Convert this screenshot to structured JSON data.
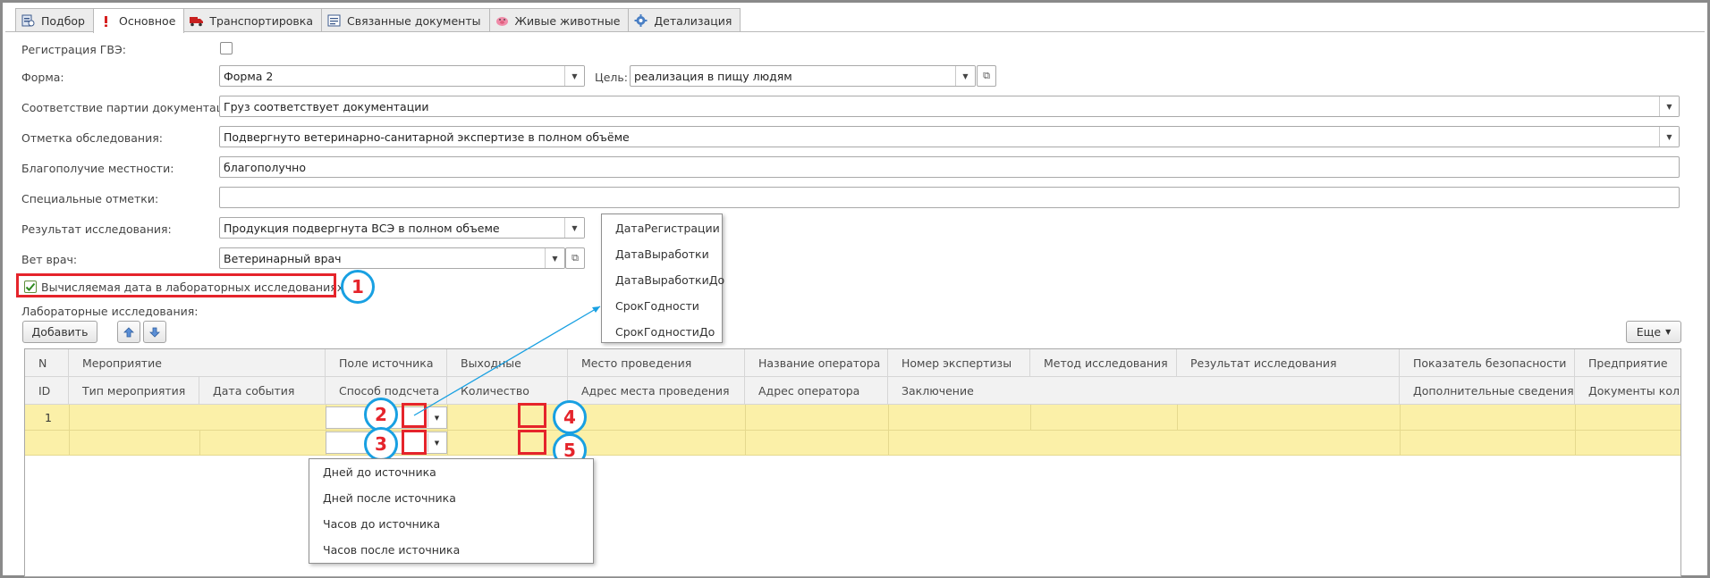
{
  "tabs": [
    {
      "label": "Подбор",
      "icon": "selection-doc-icon",
      "active": false
    },
    {
      "label": "Основное",
      "icon": "exclamation-icon",
      "active": true
    },
    {
      "label": "Транспортировка",
      "icon": "truck-icon",
      "active": false
    },
    {
      "label": "Связанные документы",
      "icon": "linked-docs-icon",
      "active": false
    },
    {
      "label": "Живые животные",
      "icon": "pig-icon",
      "active": false
    },
    {
      "label": "Детализация",
      "icon": "gear-icon",
      "active": false
    }
  ],
  "form": {
    "gve_label": "Регистрация ГВЭ:",
    "forma_label": "Форма:",
    "forma_value": "Форма 2",
    "goal_label": "Цель:",
    "goal_value": "реализация в пищу людям",
    "conformity_label": "Соответствие партии документации:",
    "conformity_value": "Груз соответствует документации",
    "inspection_label": "Отметка обследования:",
    "inspection_value": "Подвергнуто ветеринарно-санитарной экспертизе в полном объёме",
    "wellbeing_label": "Благополучие местности:",
    "wellbeing_value": "благополучно",
    "special_label": "Специальные отметки:",
    "special_value": "",
    "result_label": "Результат исследования:",
    "result_value": "Продукция подвергнута ВСЭ в полном объеме",
    "vet_label": "Вет врач:",
    "vet_value": "Ветеринарный врач",
    "computed_date_label": "Вычисляемая дата в лабораторных исследованиях",
    "lab_label": "Лабораторные исследования:"
  },
  "toolbar": {
    "add": "Добавить",
    "more": "Еще"
  },
  "source_field_options": [
    "ДатаРегистрации",
    "ДатаВыработки",
    "ДатаВыработкиДо",
    "СрокГодности",
    "СрокГодностиДо"
  ],
  "calc_method_options": [
    "Дней до источника",
    "Дней после источника",
    "Часов до источника",
    "Часов после источника"
  ],
  "grid": {
    "header_row1": [
      "N",
      "Мероприятие",
      "Поле источника",
      "Выходные",
      "Место проведения",
      "Название оператора",
      "Номер экспертизы",
      "Метод исследования",
      "Результат исследования",
      "Показатель безопасности",
      "Предприятие"
    ],
    "header_row2": [
      "ID",
      "Тип мероприятия",
      "Дата события",
      "Способ подсчета",
      "Количество",
      "Адрес места проведения",
      "Адрес оператора",
      "Заключение",
      "Дополнительные сведения",
      "Документы количест"
    ],
    "rows": [
      {
        "n": "1"
      }
    ]
  },
  "callouts": [
    "1",
    "2",
    "3",
    "4",
    "5"
  ],
  "colors": {
    "callout_red": "#e5242b",
    "callout_blue": "#18a0e2",
    "row_highlight": "#fbf0a8"
  }
}
